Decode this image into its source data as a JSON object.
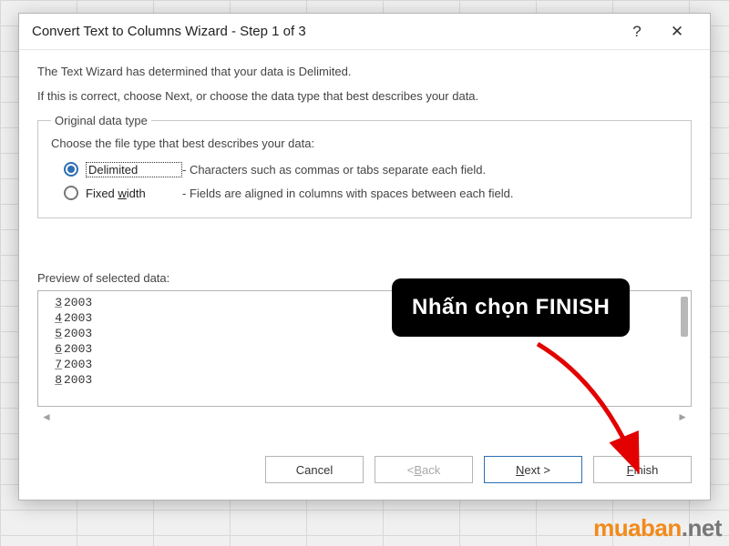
{
  "dialog": {
    "title": "Convert Text to Columns Wizard - Step 1 of 3",
    "help_glyph": "?",
    "close_glyph": "✕",
    "intro1": "The Text Wizard has determined that your data is Delimited.",
    "intro2": "If this is correct, choose Next, or choose the data type that best describes your data.",
    "group_title": "Original data type",
    "choose_text": "Choose the file type that best describes your data:",
    "radio1": {
      "label": "Delimited",
      "desc": "- Characters such as commas or tabs separate each field."
    },
    "radio2_prefix": "Fixed ",
    "radio2_u": "w",
    "radio2_suffix": "idth",
    "radio2_desc": "- Fields are aligned in columns with spaces between each field.",
    "preview_label": "Preview of selected data:",
    "preview_rows": [
      {
        "ln": "3",
        "val": "2003"
      },
      {
        "ln": "4",
        "val": "2003"
      },
      {
        "ln": "5",
        "val": "2003"
      },
      {
        "ln": "6",
        "val": "2003"
      },
      {
        "ln": "7",
        "val": "2003"
      },
      {
        "ln": "8",
        "val": "2003"
      }
    ],
    "hscroll_left": "◄",
    "hscroll_right": "►",
    "buttons": {
      "cancel": "Cancel",
      "back_lt": "< ",
      "back_u": "B",
      "back_rest": "ack",
      "next_u": "N",
      "next_rest": "ext >",
      "finish_u": "F",
      "finish_rest": "inish"
    }
  },
  "callout": "Nhấn chọn  FINISH",
  "logo": {
    "part1": "muaban",
    "part2": ".net"
  }
}
